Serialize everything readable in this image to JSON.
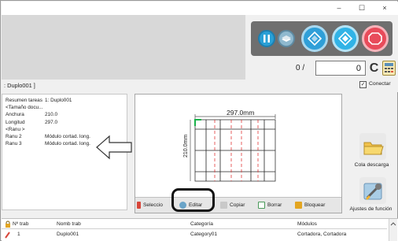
{
  "window": {
    "minimize_glyph": "–",
    "maximize_glyph": "☐",
    "close_glyph": "×"
  },
  "controls": {
    "colors": {
      "panel": "#6f6f6f",
      "pause": "#2aa0d6",
      "start": "#31b3e6",
      "stop": "#e84b5a"
    }
  },
  "counter": {
    "current": "0 /",
    "total": "0",
    "clear_label": "C"
  },
  "connect": {
    "label": "Conectar",
    "checked": true
  },
  "job_title": ": Duplo001 ]",
  "properties": [
    {
      "key": "Resumen tareas",
      "value": "1: Duplo001"
    },
    {
      "key": "<Tamaño docu...",
      "value": ""
    },
    {
      "key": "Anchura",
      "value": "210.0"
    },
    {
      "key": "Longitud",
      "value": "297.0"
    },
    {
      "key": "<Ranu >",
      "value": ""
    },
    {
      "key": "Ranu 2",
      "value": "Módulo cortad. long."
    },
    {
      "key": "Ranu 3",
      "value": "Módulo cortad. long."
    }
  ],
  "preview": {
    "width_label": "297.0mm",
    "height_label": "210.0mm"
  },
  "preview_toolbar": {
    "select": "Seleccio",
    "edit": "Editar",
    "copy": "Copiar",
    "delete": "Borrar",
    "lock": "Bloquear"
  },
  "side": {
    "queue_label": "Cola descarga",
    "settings_label": "Ajustes de función"
  },
  "table": {
    "headers": [
      "Nº trab",
      "Nomb trab",
      "Categoría",
      "Módulos"
    ],
    "rows": [
      {
        "num": "1",
        "name": "Duplo001",
        "category": "Category01",
        "modules": "Cortadora, Cortadora"
      }
    ]
  }
}
